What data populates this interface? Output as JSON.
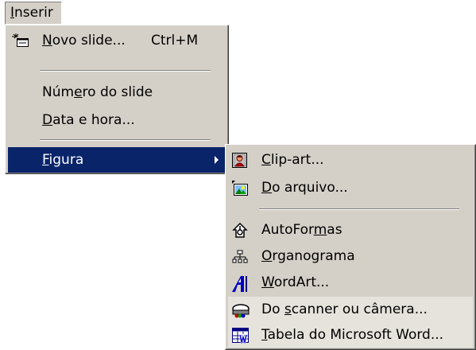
{
  "menubar": {
    "active_menu": "Inserir"
  },
  "inserir_menu": {
    "items": [
      {
        "label": "Novo slide...",
        "shortcut": "Ctrl+M",
        "icon": "new-slide-icon"
      },
      {
        "label": "Número do slide"
      },
      {
        "label": "Data e hora..."
      },
      {
        "label": "Figura",
        "has_submenu": true,
        "highlighted": true
      }
    ]
  },
  "figura_submenu": {
    "items": [
      {
        "label": "Clip-art...",
        "icon": "clip-art-icon"
      },
      {
        "label": "Do arquivo...",
        "icon": "picture-from-file-icon"
      },
      {
        "label": "AutoFormas",
        "icon": "autoshapes-icon"
      },
      {
        "label": "Organograma",
        "icon": "org-chart-icon"
      },
      {
        "label": "WordArt...",
        "icon": "wordart-icon"
      },
      {
        "label": "Do scanner ou câmera...",
        "icon": "scanner-camera-icon"
      },
      {
        "label": "Tabela do Microsoft Word...",
        "icon": "word-table-icon"
      }
    ]
  },
  "colors": {
    "menu_background": "#d4d0c8",
    "highlight_background": "#0a246a",
    "highlight_text": "#ffffff",
    "rarely_used_background": "#e6e3dc"
  }
}
